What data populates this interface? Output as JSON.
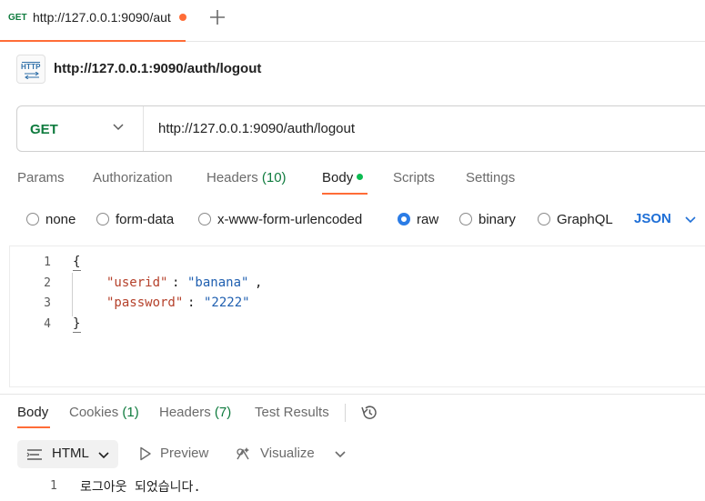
{
  "tab": {
    "method": "GET",
    "url": "http://127.0.0.1:9090/aut"
  },
  "request": {
    "title": "http://127.0.0.1:9090/auth/logout",
    "icon_text": "HTTP",
    "method": "GET",
    "url": "http://127.0.0.1:9090/auth/logout"
  },
  "request_tabs": {
    "params": "Params",
    "authorization": "Authorization",
    "headers": "Headers",
    "headers_count": "(10)",
    "body": "Body",
    "scripts": "Scripts",
    "settings": "Settings"
  },
  "body_types": {
    "none": "none",
    "form_data": "form-data",
    "urlencoded": "x-www-form-urlencoded",
    "raw": "raw",
    "binary": "binary",
    "graphql": "GraphQL",
    "selected": "raw",
    "language": "JSON"
  },
  "editor": {
    "line_numbers": [
      "1",
      "2",
      "3",
      "4"
    ],
    "open_brace": "{",
    "close_brace": "}",
    "key1": "\"userid\"",
    "val1": "\"banana\"",
    "key2": "\"password\"",
    "val2": "\"2222\"",
    "colon": ":",
    "comma": ","
  },
  "response_tabs": {
    "body": "Body",
    "cookies": "Cookies",
    "cookies_count": "(1)",
    "headers": "Headers",
    "headers_count": "(7)",
    "test_results": "Test Results"
  },
  "response_toolbar": {
    "format": "HTML",
    "preview": "Preview",
    "visualize": "Visualize"
  },
  "response_body": {
    "line_number": "1",
    "text": "로그아웃 되었습니다."
  },
  "colors": {
    "accent": "#ff6c37",
    "get_method": "#0f7b3e",
    "link_blue": "#1f6fd6",
    "radio_selected": "#2b7ce6",
    "json_key": "#b5412b",
    "json_string": "#1f5fb0"
  },
  "icons": {
    "new_tab": "plus-icon",
    "unsaved": "unsaved-dot-icon",
    "request_type": "http-icon",
    "method_dropdown": "chevron-down-icon",
    "history": "history-icon",
    "format": "wrap-lines-icon",
    "preview": "play-icon",
    "visualize": "visualize-icon"
  }
}
